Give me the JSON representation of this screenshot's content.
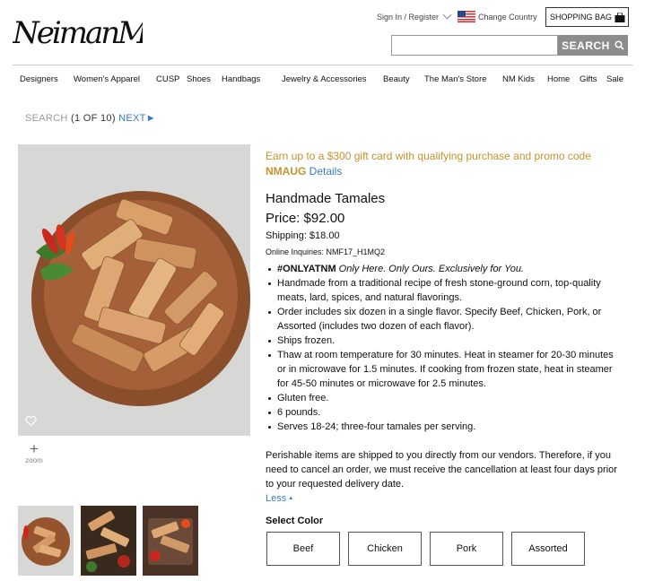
{
  "header": {
    "logo_text": "NeimanMarcus",
    "sign_in": "Sign In / Register",
    "change_country": "Change Country",
    "shopping_bag": "SHOPPING BAG",
    "search_placeholder": "",
    "search_button": "SEARCH"
  },
  "nav": {
    "items": [
      "Designers",
      "Women's Apparel",
      "CUSP",
      "Shoes",
      "Handbags",
      "Jewelry & Accessories",
      "Beauty",
      "The Man's Store",
      "NM Kids",
      "Home",
      "Gifts",
      "Sale"
    ]
  },
  "breadcrumb": {
    "search": "SEARCH",
    "count": "(1 OF 10)",
    "next": "NEXT►"
  },
  "gallery": {
    "zoom_label": "zoom",
    "plus": "+"
  },
  "product": {
    "promo_text": "Earn up to a $300 gift card with qualifying purchase and promo code",
    "promo_code": "NMAUG",
    "promo_details": "Details",
    "title": "Handmade Tamales",
    "price": "Price:  $92.00",
    "shipping": "Shipping:  $18.00",
    "inquiries": "Online Inquiries: NMF17_H1MQ2",
    "only_tag": "#ONLYATNM",
    "only_desc": "Only Here. Only Ours. Exclusively for You.",
    "bullets": [
      "Handmade from a traditional recipe of fresh stone-ground corn, top-quality meats, lard, spices, and natural flavorings.",
      "Order includes six dozen in a single flavor. Specify Beef, Chicken, Pork, or Assorted (includes two dozen of each flavor).",
      "Ships frozen.",
      "Thaw at room temperature for 30 minutes. Heat in steamer for 20-30 minutes or in microwave for 1.5 minutes. If cooking from frozen state, heat in steamer for 45-50 minutes or microwave for 2.5 minutes.",
      "Gluten free.",
      "6 pounds.",
      "Serves 18-24; three-four tamales per serving."
    ],
    "perishable": "Perishable items are shipped to you directly from our vendors. Therefore, if you need to cancel an order, we must receive the cancellation at least four days prior to your requested delivery date.",
    "less": "Less",
    "select_color_label": "Select Color",
    "colors": [
      "Beef",
      "Chicken",
      "Pork",
      "Assorted"
    ]
  },
  "theme": {
    "promo_color": "#c5922d",
    "link_color": "#3a7bbf",
    "search_button_bg": "#8c8c8c"
  }
}
